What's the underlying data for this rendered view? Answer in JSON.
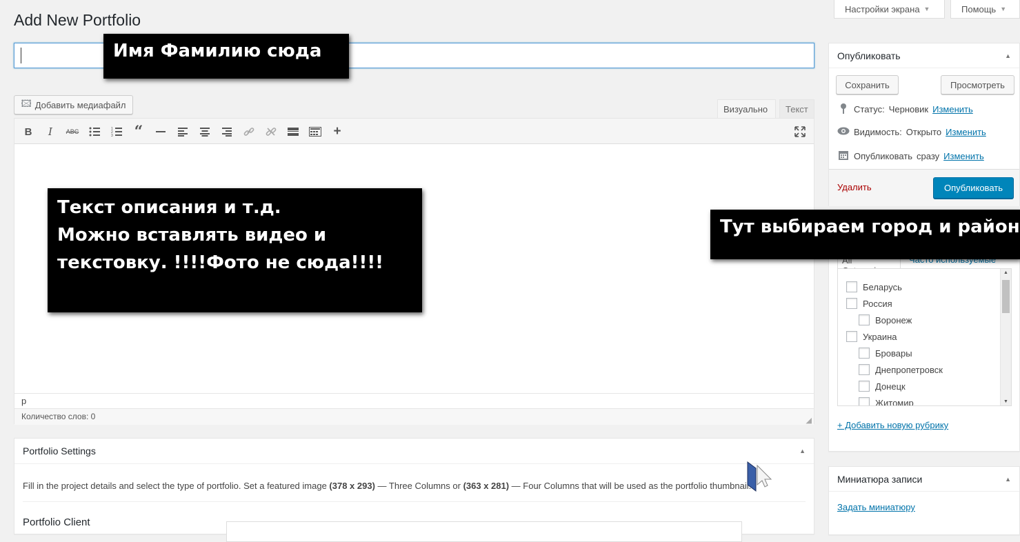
{
  "screen_meta": {
    "screen_options": "Настройки экрана",
    "help": "Помощь"
  },
  "page_title": "Add New Portfolio",
  "title_field": {
    "value": ""
  },
  "annotations": {
    "name_hint": "Имя Фамилию сюда",
    "content_hint_lines": [
      "Текст описания и т.д.",
      "Можно вставлять видео и",
      "текстовку. !!!!Фото не сюда!!!!"
    ],
    "category_hint": "Тут выбираем город и район"
  },
  "editor": {
    "add_media": "Добавить медиафайл",
    "tab_visual": "Визуально",
    "tab_text": "Текст",
    "toolbar": [
      "bold-icon",
      "italic-icon",
      "strikethrough-icon",
      "bullet-list-icon",
      "numbered-list-icon",
      "blockquote-icon",
      "horizontal-rule-icon",
      "align-left-icon",
      "align-center-icon",
      "align-right-icon",
      "link-icon",
      "unlink-icon",
      "read-more-icon",
      "toolbar-toggle-icon",
      "add-icon"
    ],
    "path": "p",
    "word_count_label": "Количество слов: 0"
  },
  "publish": {
    "title": "Опубликовать",
    "save_draft": "Сохранить",
    "preview": "Просмотреть",
    "status_label": "Статус: ",
    "status_value": "Черновик",
    "visibility_label": "Видимость: ",
    "visibility_value": "Открыто",
    "schedule_label": "Опубликовать ",
    "schedule_value": "сразу",
    "edit_link": "Изменить",
    "delete": "Удалить",
    "publish_button": "Опубликовать"
  },
  "categories": {
    "tab_all": "All Categories",
    "tab_popular": "Часто используемые",
    "items": [
      {
        "label": "Беларусь",
        "child": false
      },
      {
        "label": "Россия",
        "child": false
      },
      {
        "label": "Воронеж",
        "child": true
      },
      {
        "label": "Украина",
        "child": false
      },
      {
        "label": "Бровары",
        "child": true
      },
      {
        "label": "Днепропетровск",
        "child": true
      },
      {
        "label": "Донецк",
        "child": true
      },
      {
        "label": "Житомир",
        "child": true
      }
    ],
    "add_new": "+ Добавить новую рубрику"
  },
  "portfolio_settings": {
    "title": "Portfolio Settings",
    "description_parts": [
      "Fill in the project details and select the type of portfolio. Set a featured image ",
      "(378 x 293)",
      " — Three Columns or ",
      "(363 x 281)",
      " — Four Columns that will be used as the portfolio thumbnail."
    ],
    "client_label": "Portfolio Client"
  },
  "thumbnail": {
    "title": "Миниатюра записи",
    "set_link": "Задать миниатюру"
  },
  "colors": {
    "primary": "#0085ba",
    "link": "#0073aa",
    "delete": "#a00"
  }
}
